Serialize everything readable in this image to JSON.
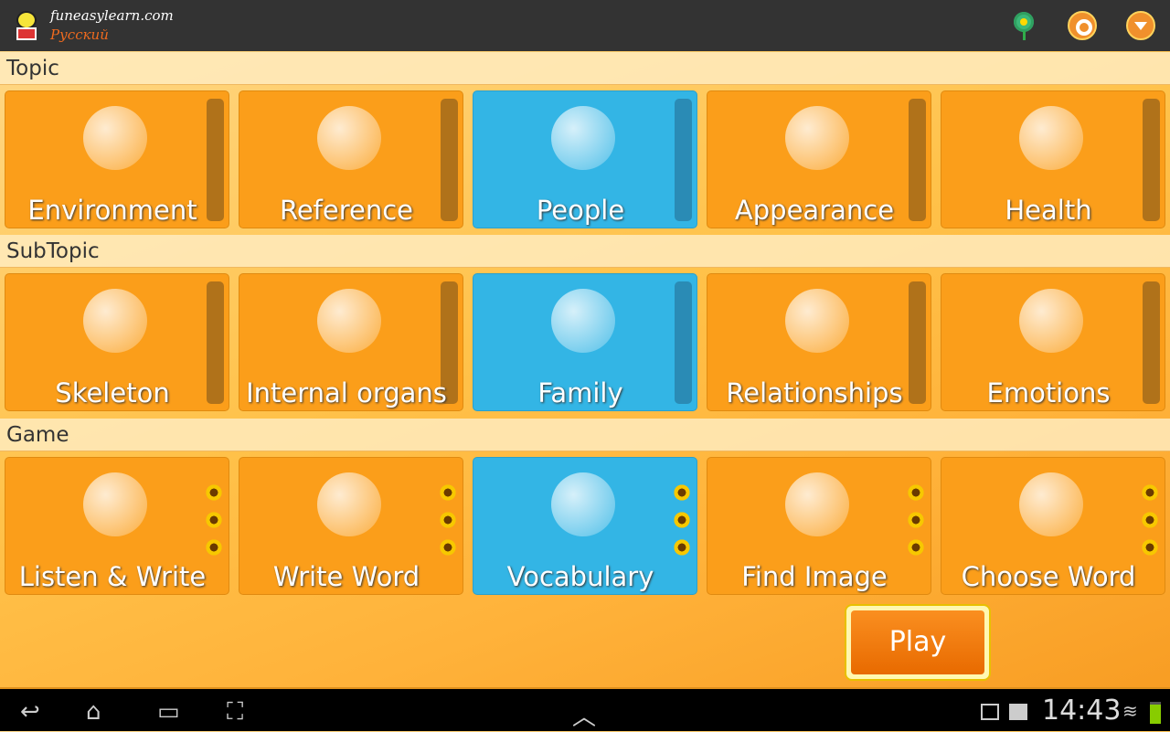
{
  "header": {
    "site": "funeasylearn.com",
    "language": "Русский",
    "icons": [
      "flower-icon",
      "settings-gear-icon",
      "dropdown-menu-icon"
    ]
  },
  "sections": [
    {
      "title": "Topic",
      "tiles": [
        {
          "label": "Environment",
          "icon": "weather-icon"
        },
        {
          "label": "Reference",
          "icon": "magnifier-icon"
        },
        {
          "label": "People",
          "icon": "globe-person-icon",
          "selected": true
        },
        {
          "label": "Appearance",
          "icon": "suit-man-icon"
        },
        {
          "label": "Health",
          "icon": "shield-caduceus-icon"
        }
      ]
    },
    {
      "title": "SubTopic",
      "tiles": [
        {
          "label": "Skeleton",
          "icon": "skull-icon"
        },
        {
          "label": "Internal organs",
          "icon": "heart-icon"
        },
        {
          "label": "Family",
          "icon": "family-icon",
          "selected": true
        },
        {
          "label": "Relationships",
          "icon": "couple-icon"
        },
        {
          "label": "Emotions",
          "icon": "smiley-icon"
        }
      ]
    },
    {
      "title": "Game",
      "tiles": [
        {
          "label": "Listen & Write",
          "icon": "chalkboard-icon"
        },
        {
          "label": "Write Word",
          "icon": "letter-pen-icon"
        },
        {
          "label": "Vocabulary",
          "icon": "books-icon",
          "selected": true
        },
        {
          "label": "Find Image",
          "icon": "photos-icon"
        },
        {
          "label": "Choose Word",
          "icon": "w-letter-icon"
        }
      ]
    }
  ],
  "play_label": "Play",
  "status": {
    "time": "14:43"
  },
  "colors": {
    "tile": "#fb9e1a",
    "selected": "#33b5e5",
    "topbar": "#333333"
  }
}
